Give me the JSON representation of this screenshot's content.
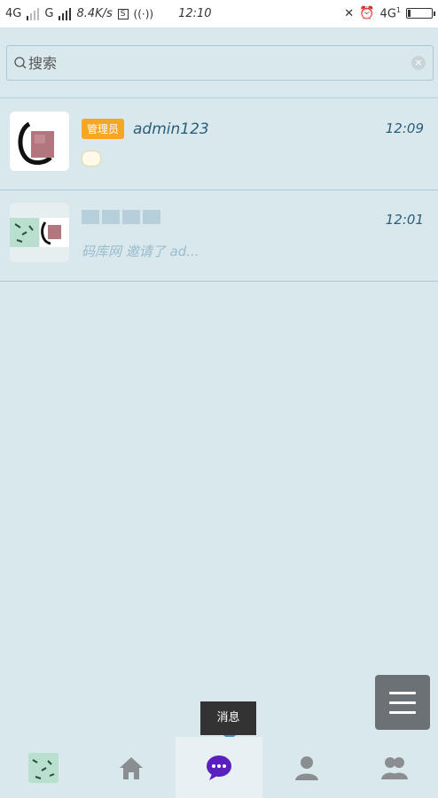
{
  "statusbar": {
    "net1": "4G",
    "net2": "G",
    "speed": "8.4K/s",
    "s_icon": "S",
    "time": "12:10",
    "net3": "4G",
    "net3_sub": "1"
  },
  "search": {
    "placeholder": "搜索"
  },
  "conversations": [
    {
      "badge": "管理员",
      "name": "admin123",
      "time": "12:09",
      "preview_icon": "sticker-emoji"
    },
    {
      "name_blurred": true,
      "time": "12:01",
      "preview": "码库网 邀请了 ad..."
    }
  ],
  "tooltip": {
    "label": "消息"
  },
  "nav": {
    "items": [
      "group-avatar",
      "home-icon",
      "chat-icon",
      "profile-icon",
      "contacts-icon"
    ],
    "active_index": 2,
    "accent": "#5b1fbf"
  }
}
